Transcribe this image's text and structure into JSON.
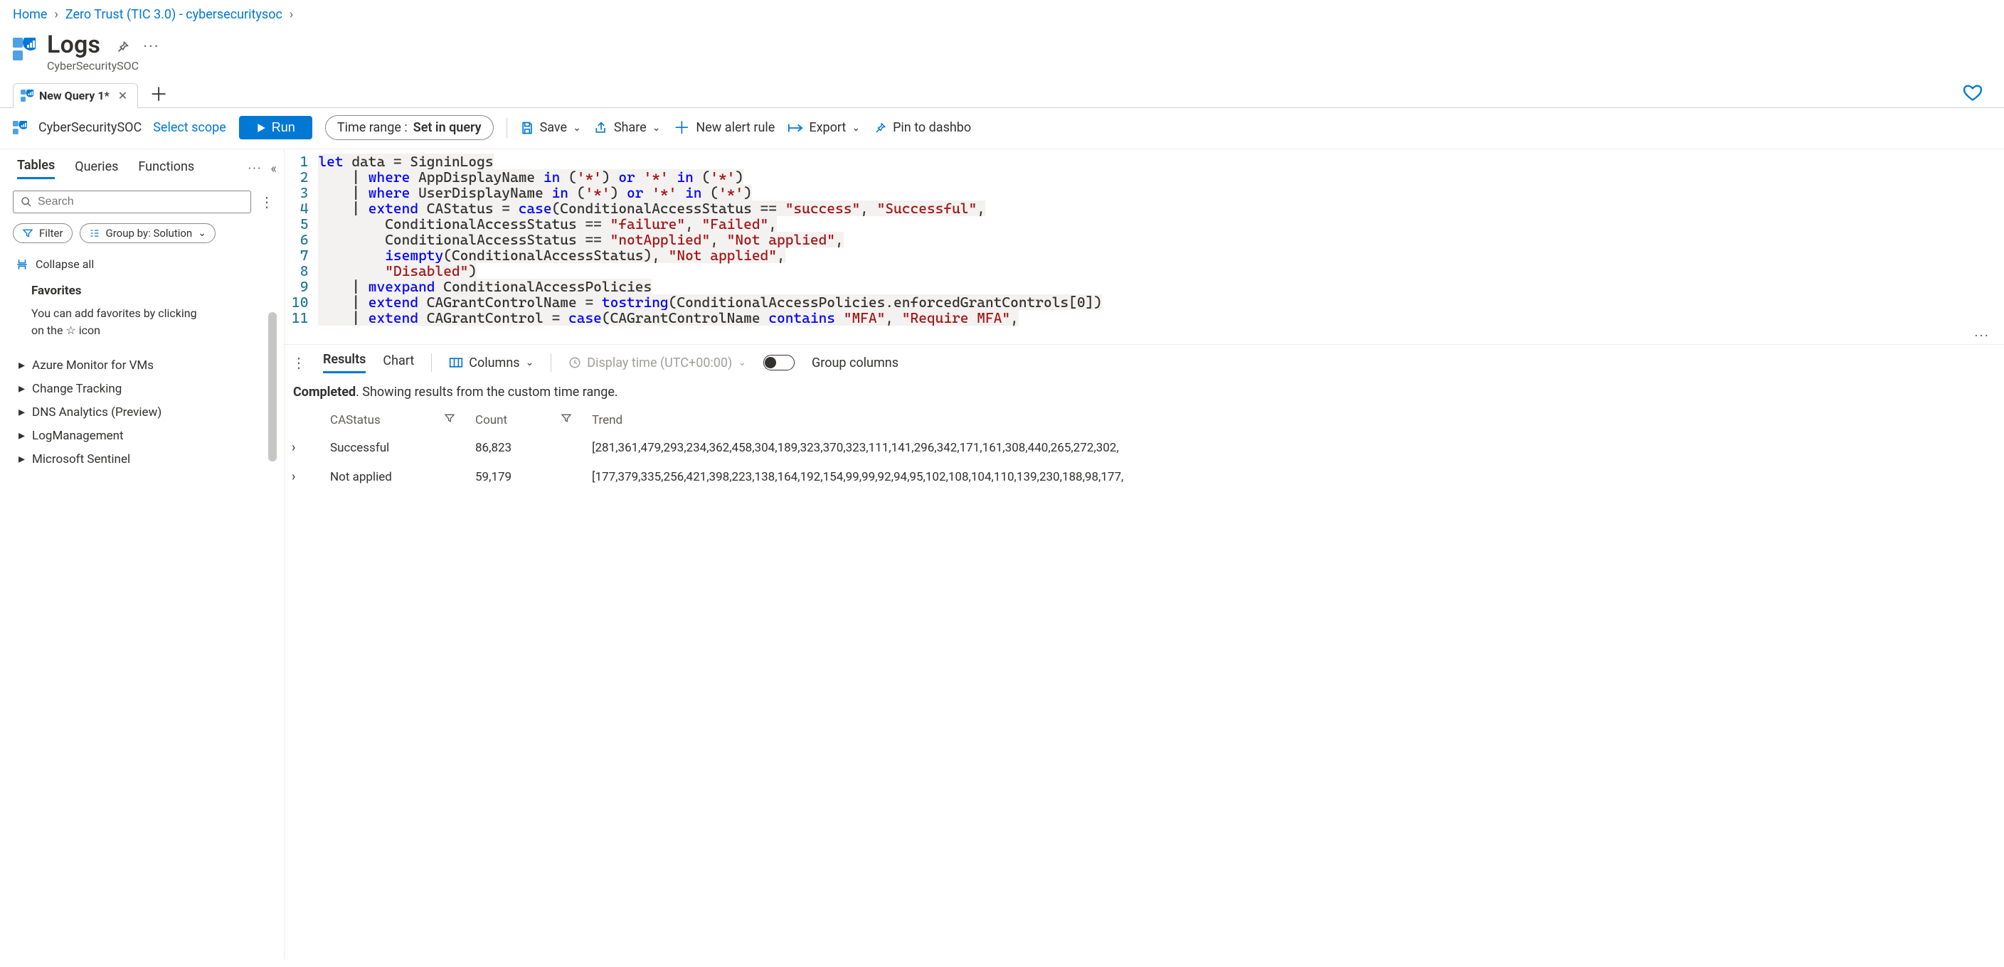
{
  "breadcrumb": {
    "home": "Home",
    "item1": "Zero Trust (TIC 3.0) - cybersecuritysoc"
  },
  "header": {
    "title": "Logs",
    "subtitle": "CyberSecuritySOC"
  },
  "tabs": {
    "query_tab_label": "New Query 1*"
  },
  "toolbar": {
    "scope": "CyberSecuritySOC",
    "select_scope": "Select scope",
    "run": "Run",
    "time_label": "Time range :",
    "time_value": "Set in query",
    "save": "Save",
    "share": "Share",
    "new_alert": "New alert rule",
    "export": "Export",
    "pin": "Pin to dashbo"
  },
  "sidebar": {
    "tabs": {
      "tables": "Tables",
      "queries": "Queries",
      "functions": "Functions"
    },
    "search_placeholder": "Search",
    "filter": "Filter",
    "group_by": "Group by: Solution",
    "collapse": "Collapse all",
    "favorites_title": "Favorites",
    "favorites_help_1": "You can add favorites by clicking",
    "favorites_help_2": "on the ☆ icon",
    "items": [
      "Azure Monitor for VMs",
      "Change Tracking",
      "DNS Analytics (Preview)",
      "LogManagement",
      "Microsoft Sentinel"
    ]
  },
  "editor": {
    "lines": [
      "let data = SigninLogs",
      "    | where AppDisplayName in ('*') or '*' in ('*')",
      "    | where UserDisplayName in ('*') or '*' in ('*')",
      "    | extend CAStatus = case(ConditionalAccessStatus == \"success\", \"Successful\",",
      "        ConditionalAccessStatus == \"failure\", \"Failed\",",
      "        ConditionalAccessStatus == \"notApplied\", \"Not applied\",",
      "        isempty(ConditionalAccessStatus), \"Not applied\",",
      "        \"Disabled\")",
      "    | mvexpand ConditionalAccessPolicies",
      "    | extend CAGrantControlName = tostring(ConditionalAccessPolicies.enforcedGrantControls[0])",
      "    | extend CAGrantControl = case(CAGrantControlName contains \"MFA\", \"Require MFA\","
    ]
  },
  "results": {
    "tab_results": "Results",
    "tab_chart": "Chart",
    "columns": "Columns",
    "display_time": "Display time (UTC+00:00)",
    "group_columns": "Group columns",
    "status": {
      "completed": "Completed",
      "tail": ". Showing results from the custom time range."
    },
    "headers": {
      "c1": "CAStatus",
      "c2": "Count",
      "c3": "Trend"
    },
    "rows": [
      {
        "status": "Successful",
        "count": "86,823",
        "trend": "[281,361,479,293,234,362,458,304,189,323,370,323,111,141,296,342,171,161,308,440,265,272,302,"
      },
      {
        "status": "Not applied",
        "count": "59,179",
        "trend": "[177,379,335,256,421,398,223,138,164,192,154,99,99,92,94,95,102,108,104,110,139,230,188,98,177,"
      }
    ]
  }
}
